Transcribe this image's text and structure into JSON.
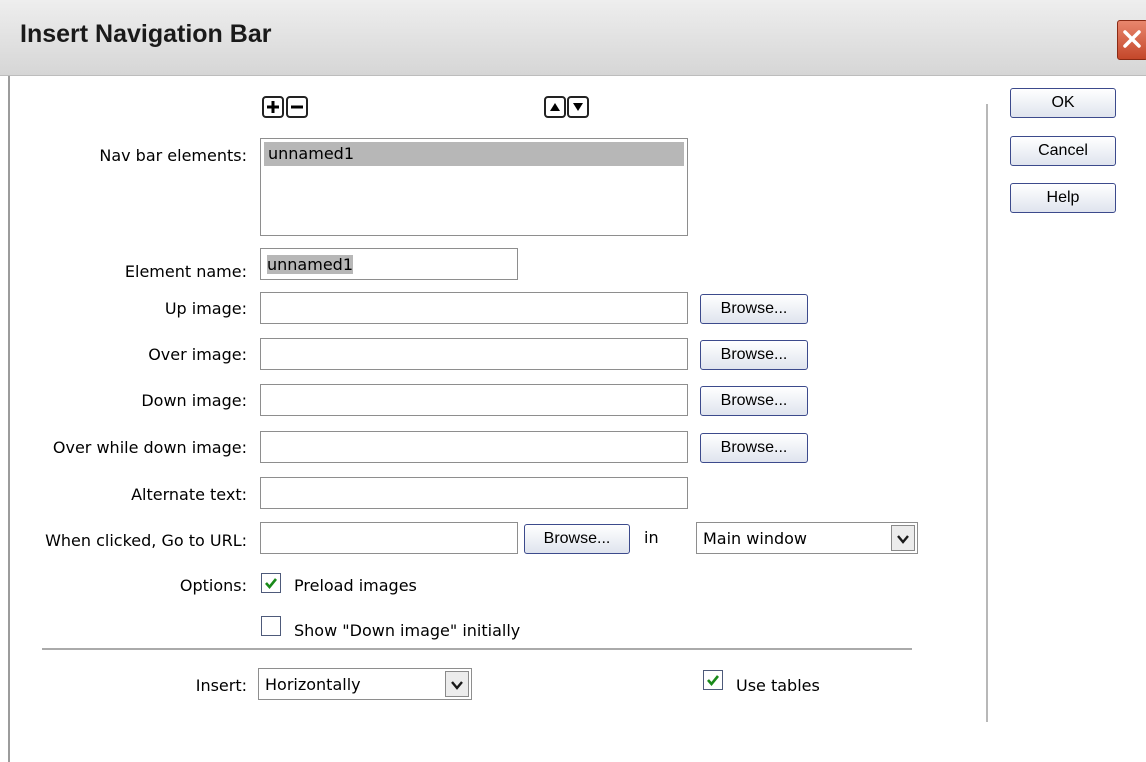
{
  "window": {
    "title": "Insert Navigation Bar"
  },
  "icons": {
    "add": "plus-icon",
    "remove": "minus-icon",
    "up": "arrow-up-icon",
    "down": "arrow-down-icon",
    "close": "close-icon",
    "check": "checkmark-icon",
    "dropdown": "chevron-down-icon"
  },
  "nav": {
    "label": "Nav bar elements:",
    "items": [
      "unnamed1"
    ],
    "selected_index": 0
  },
  "element_name": {
    "label": "Element name:",
    "value": "unnamed1"
  },
  "images": {
    "up": {
      "label": "Up image:",
      "value": "",
      "browse": "Browse..."
    },
    "over": {
      "label": "Over image:",
      "value": "",
      "browse": "Browse..."
    },
    "down": {
      "label": "Down image:",
      "value": "",
      "browse": "Browse..."
    },
    "overdown": {
      "label": "Over while down image:",
      "value": "",
      "browse": "Browse..."
    }
  },
  "alt": {
    "label": "Alternate text:",
    "value": ""
  },
  "url": {
    "label": "When clicked, Go to URL:",
    "value": "",
    "browse": "Browse...",
    "in_label": "in",
    "target": "Main window"
  },
  "options": {
    "label": "Options:",
    "preload": {
      "label": "Preload images",
      "checked": true
    },
    "show_down": {
      "label": "Show \"Down image\" initially",
      "checked": false
    }
  },
  "insert": {
    "label": "Insert:",
    "value": "Horizontally"
  },
  "use_tables": {
    "label": "Use tables",
    "checked": true
  },
  "actions": {
    "ok": "OK",
    "cancel": "Cancel",
    "help": "Help"
  },
  "colors": {
    "button_border": "#3c4a8c",
    "selection": "#b7b7b7",
    "check": "#1a8a1a",
    "close_button": "#c4472a"
  }
}
